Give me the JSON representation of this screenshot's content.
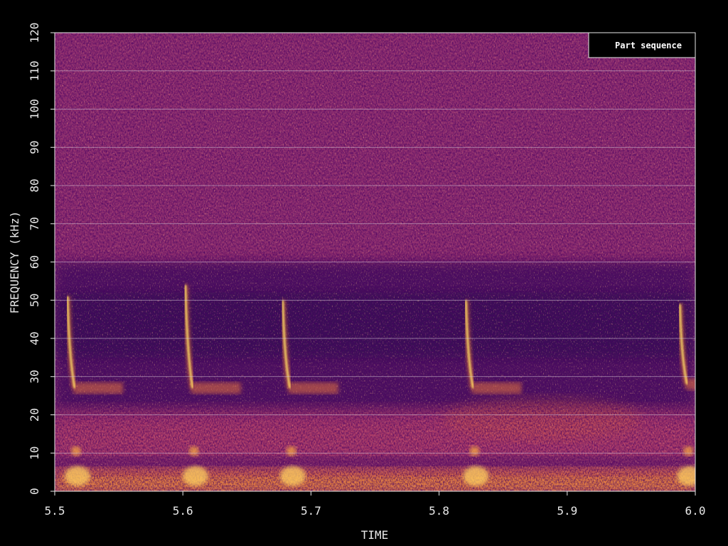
{
  "chart_data": {
    "type": "heatmap",
    "title": "",
    "xlabel": "TIME",
    "ylabel": "FREQUENCY (kHz)",
    "xlim": [
      5.5,
      6.0
    ],
    "ylim": [
      0,
      120
    ],
    "x_ticks": [
      "5.5",
      "5.6",
      "5.7",
      "5.8",
      "5.9",
      "6.0"
    ],
    "y_ticks": [
      "0",
      "10",
      "20",
      "30",
      "40",
      "50",
      "60",
      "70",
      "80",
      "90",
      "100",
      "110",
      "120"
    ],
    "grid": "horizontal",
    "legend": {
      "placement": "top-right",
      "entries": [
        "Part sequence"
      ]
    },
    "colormap": "inferno",
    "calls": [
      {
        "onset_time": 5.51,
        "start_khz": 51,
        "end_khz": 27
      },
      {
        "onset_time": 5.602,
        "start_khz": 54,
        "end_khz": 27
      },
      {
        "onset_time": 5.678,
        "start_khz": 50,
        "end_khz": 27
      },
      {
        "onset_time": 5.821,
        "start_khz": 50,
        "end_khz": 27
      },
      {
        "onset_time": 5.988,
        "start_khz": 49,
        "end_khz": 28
      }
    ],
    "low_band_khz": [
      0,
      8
    ]
  },
  "colors": {
    "background": "#000000",
    "axis": "#e8e8e8",
    "grid": "#d8c8d8"
  }
}
